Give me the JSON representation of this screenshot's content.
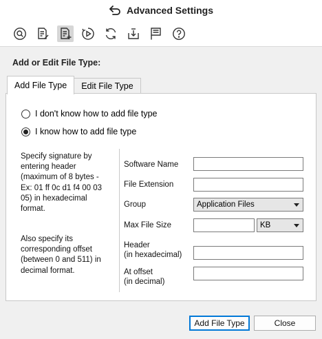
{
  "window": {
    "title": "Advanced Settings",
    "back_icon": "undo-arrow-icon"
  },
  "toolbar": {
    "buttons": [
      {
        "icon": "scan-icon",
        "active": false
      },
      {
        "icon": "document-edit-icon",
        "active": false
      },
      {
        "icon": "document-add-icon",
        "active": true
      },
      {
        "icon": "play-document-icon",
        "active": false
      },
      {
        "icon": "refresh-icon",
        "active": false
      },
      {
        "icon": "download-icon",
        "active": false
      },
      {
        "icon": "flag-list-icon",
        "active": false
      },
      {
        "icon": "help-icon",
        "active": false
      }
    ]
  },
  "heading": "Add or Edit File Type:",
  "tabs": [
    {
      "label": "Add File Type",
      "selected": true
    },
    {
      "label": "Edit File Type",
      "selected": false
    }
  ],
  "options": {
    "unknown": {
      "label": "I don't know how to add file type",
      "checked": false
    },
    "known": {
      "label": "I know how to add file type",
      "checked": true
    }
  },
  "help": {
    "signature": "Specify signature by entering header (maximum of 8 bytes - Ex: 01 ff 0c d1 f4 00 03 05) in hexadecimal format.",
    "offset": "Also specify its corresponding offset (between 0 and 511) in decimal format."
  },
  "form": {
    "software_name": {
      "label": "Software Name",
      "value": ""
    },
    "file_extension": {
      "label": "File Extension",
      "value": ""
    },
    "group": {
      "label": "Group",
      "value": "Application Files"
    },
    "max_file_size": {
      "label": "Max File Size",
      "value": "",
      "unit": "KB"
    },
    "header": {
      "label_line1": "Header",
      "label_line2": "(in hexadecimal)",
      "value": ""
    },
    "offset": {
      "label_line1": "At offset",
      "label_line2": "(in decimal)",
      "value": ""
    }
  },
  "actions": {
    "add_label": "Add File Type",
    "close_label": "Close"
  }
}
